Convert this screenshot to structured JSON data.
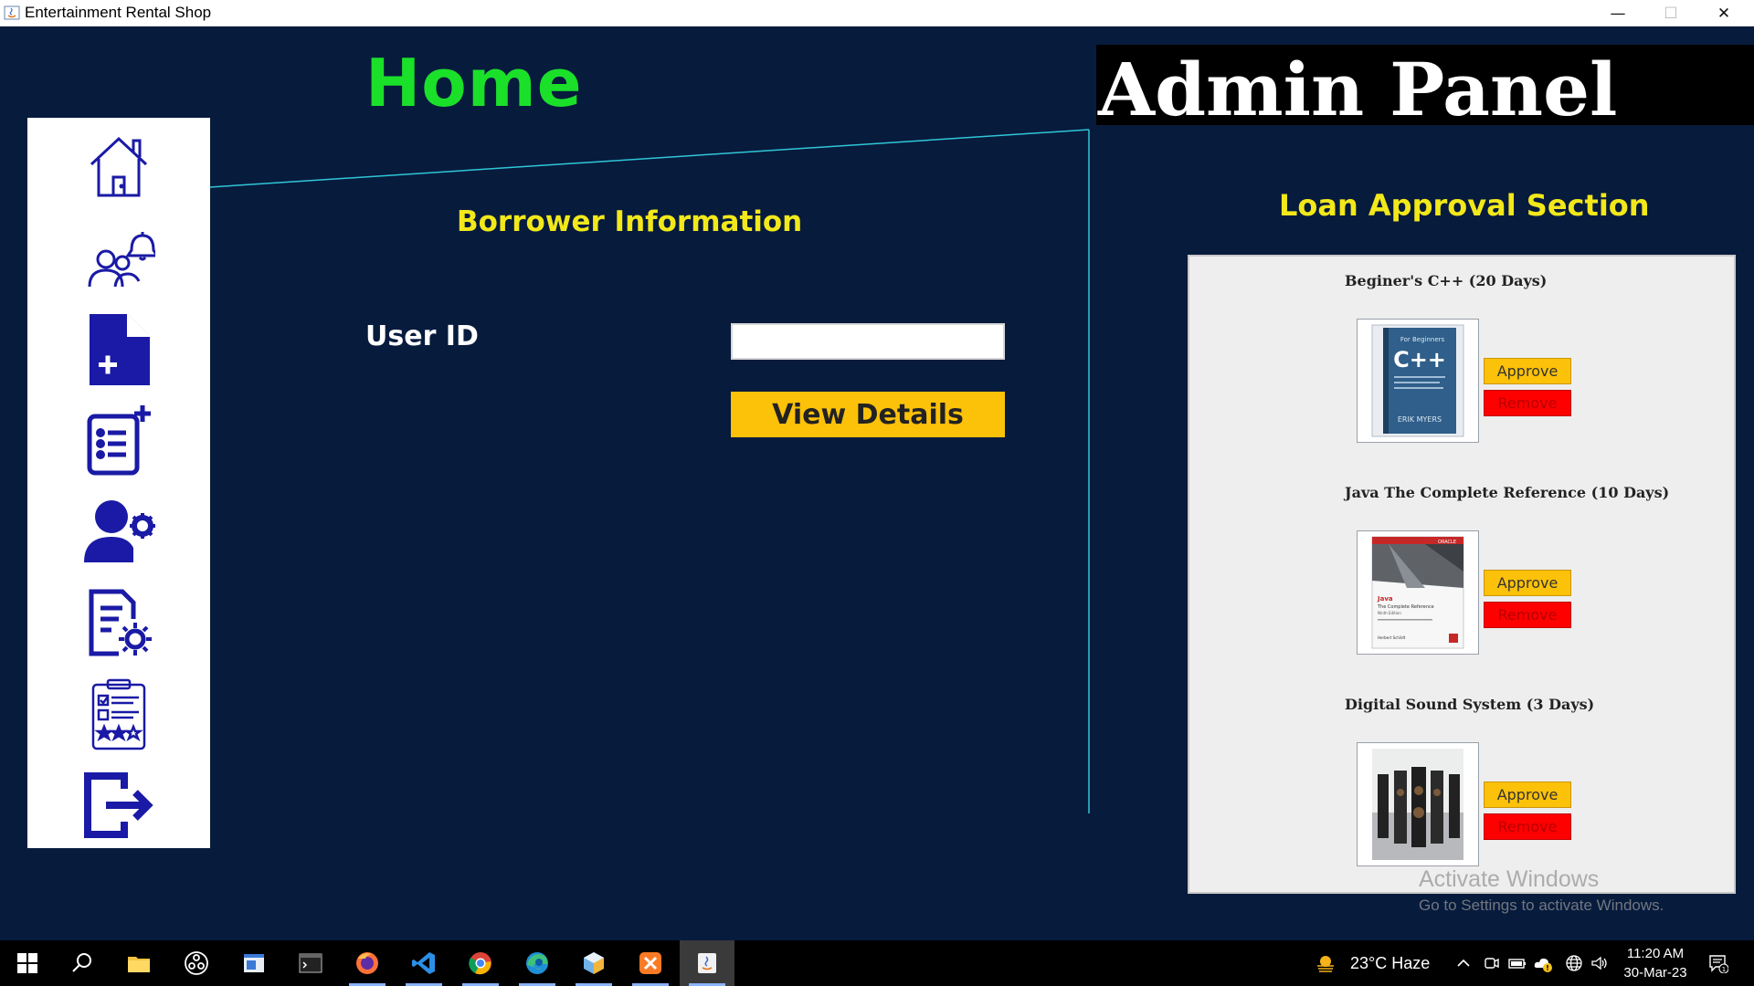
{
  "window": {
    "title": "Entertainment Rental Shop",
    "controls": {
      "minimize": "—",
      "maximize": "☐",
      "close": "✕"
    }
  },
  "header": {
    "home_title": "Home",
    "admin_title": "Admin Panel"
  },
  "sidebar": {
    "items": [
      {
        "icon": "home-icon"
      },
      {
        "icon": "users-notification-icon"
      },
      {
        "icon": "add-document-icon"
      },
      {
        "icon": "add-list-icon"
      },
      {
        "icon": "user-settings-icon"
      },
      {
        "icon": "document-settings-icon"
      },
      {
        "icon": "checklist-rating-icon"
      },
      {
        "icon": "logout-icon"
      }
    ]
  },
  "borrower": {
    "title": "Borrower Information",
    "user_id_label": "User ID",
    "user_id_value": "",
    "view_button": "View Details"
  },
  "loan_section": {
    "title": "Loan Approval Section",
    "items": [
      {
        "title": "Beginer's C++ (20 Days)",
        "thumb": "cpp-book-cover",
        "approve": "Approve",
        "remove": "Remove"
      },
      {
        "title": "Java The Complete Reference (10 Days)",
        "thumb": "java-book-cover",
        "approve": "Approve",
        "remove": "Remove"
      },
      {
        "title": "Digital Sound System (3 Days)",
        "thumb": "sound-system-image",
        "approve": "Approve",
        "remove": "Remove"
      }
    ],
    "cover_text": {
      "cpp_top": "For Beginners",
      "cpp_main": "C++",
      "cpp_author": "ERIK MYERS",
      "java_brand": "ORACLE",
      "java_main": "Java",
      "java_sub": "The Complete Reference",
      "java_edition": "Ninth Edition",
      "java_author": "Herbert Schildt"
    }
  },
  "watermark": {
    "line1": "Activate Windows",
    "line2": "Go to Settings to activate Windows."
  },
  "taskbar": {
    "apps": [
      "start-icon",
      "search-icon",
      "file-explorer-icon",
      "obs-icon",
      "window-app-icon",
      "terminal-icon",
      "firefox-icon",
      "vscode-icon",
      "chrome-icon",
      "edge-icon",
      "box-app-icon",
      "xampp-icon",
      "java-icon"
    ],
    "weather": "23°C  Haze",
    "time": "11:20 AM",
    "date": "30-Mar-23",
    "notification_count": "1"
  },
  "colors": {
    "background": "#071b3d",
    "home_title": "#1be02a",
    "section_title": "#f2e81a",
    "approve": "#fcc109",
    "remove": "#ff0000",
    "icon_blue": "#1a1aa6"
  }
}
